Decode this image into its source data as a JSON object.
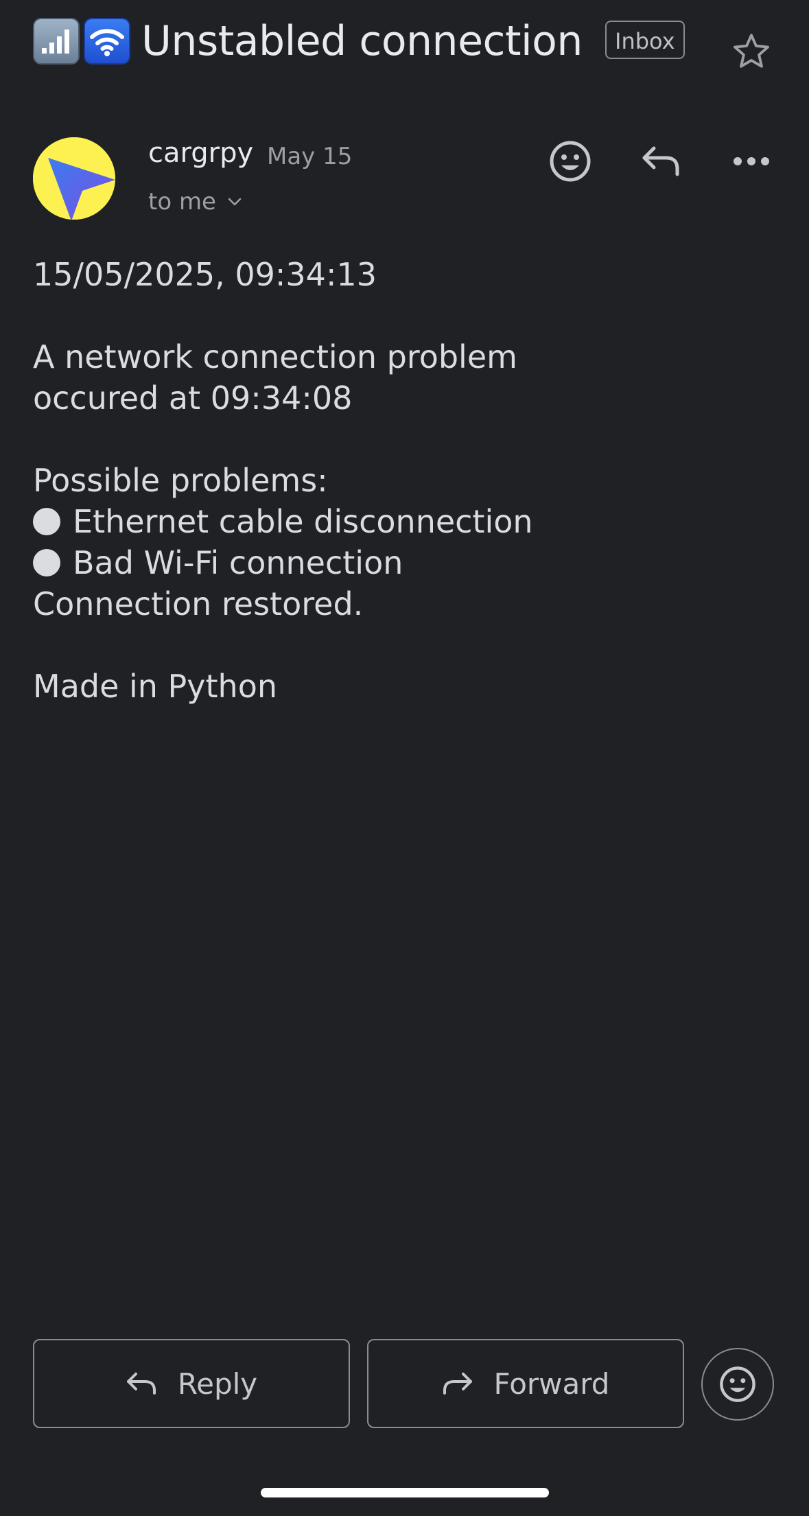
{
  "subject": {
    "icons": [
      "signal-bars-emoji",
      "wifi-emoji"
    ],
    "text": "Unstabled connection",
    "label_badge": "Inbox"
  },
  "sender": {
    "name": "cargrpy",
    "date": "May 15",
    "recipient": "to me",
    "avatar_colors": {
      "background": "#fdf152",
      "arrow": "#5b4fe6"
    }
  },
  "header_actions": [
    "emoji-reaction-icon",
    "reply-icon",
    "more-options-icon"
  ],
  "body": {
    "timestamp": "15/05/2025, 09:34:13",
    "problem_line1": "A network connection problem",
    "problem_line2": "occured at 09:34:08",
    "possible_heading": "Possible problems:",
    "bullets": [
      "Ethernet cable disconnection",
      "Bad Wi-Fi connection"
    ],
    "restored": "Connection restored.",
    "footer": "Made in Python"
  },
  "actions": {
    "reply_label": "Reply",
    "forward_label": "Forward"
  },
  "colors": {
    "background": "#202124",
    "text": "#dadce0",
    "muted": "#9aa0a6",
    "outline": "#8a8c90"
  }
}
